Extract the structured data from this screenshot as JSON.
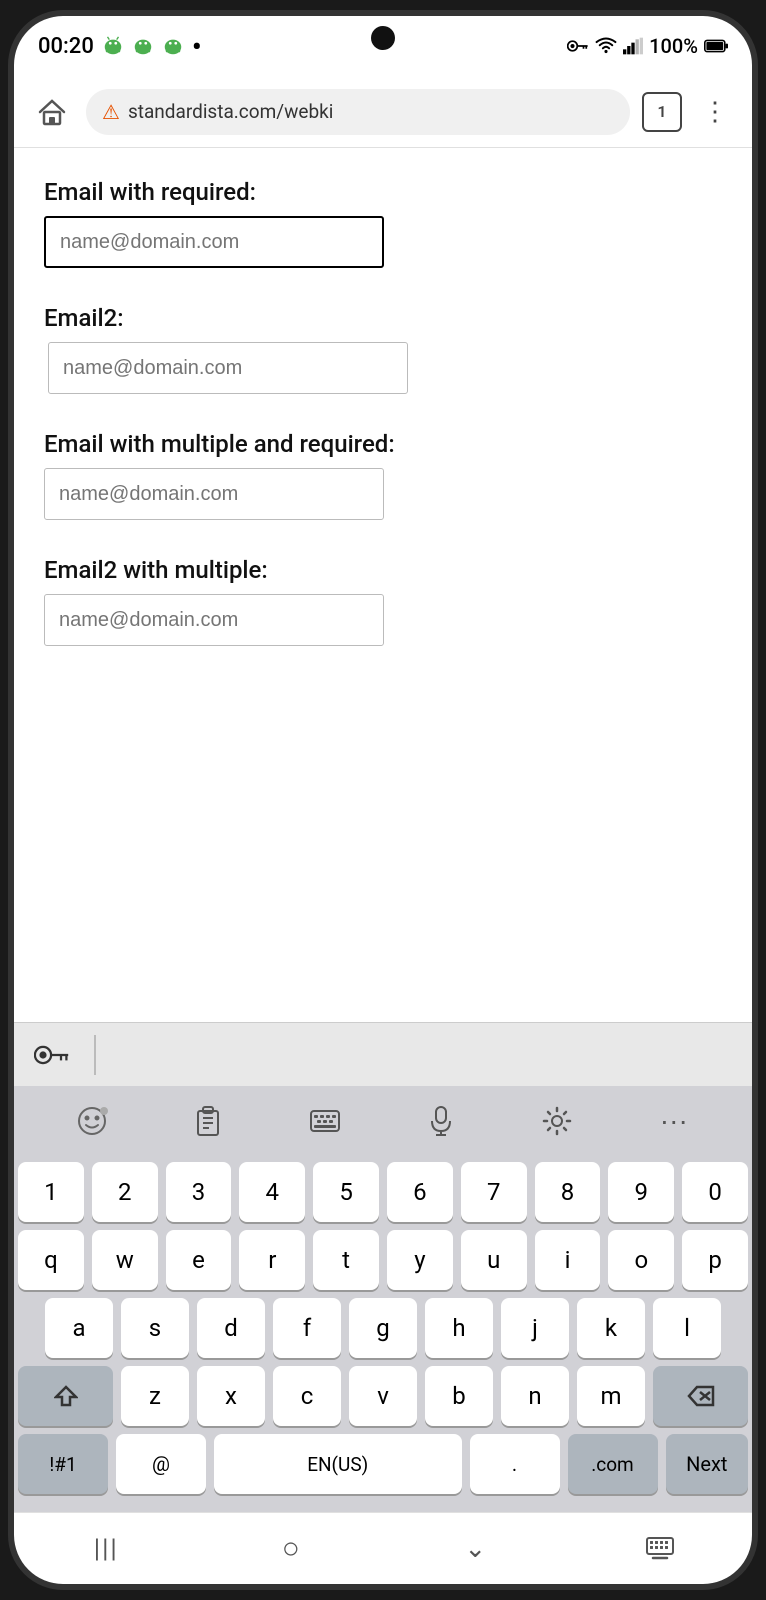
{
  "status": {
    "time": "00:20",
    "battery": "100%",
    "dot": "•"
  },
  "browser": {
    "url": "standardista.com/webki",
    "tab_count": "1"
  },
  "form": {
    "field1_label": "Email with required:",
    "field1_placeholder": "name@domain.com",
    "field2_label": "Email2:",
    "field2_placeholder": "name@domain.com",
    "field3_label": "Email with multiple and required:",
    "field3_placeholder": "name@domain.com",
    "field4_label": "Email2 with multiple:",
    "field4_placeholder": "name@domain.com"
  },
  "keyboard": {
    "row0": [
      "1",
      "2",
      "3",
      "4",
      "5",
      "6",
      "7",
      "8",
      "9",
      "0"
    ],
    "row1": [
      "q",
      "w",
      "e",
      "r",
      "t",
      "y",
      "u",
      "i",
      "o",
      "p"
    ],
    "row2": [
      "a",
      "s",
      "d",
      "f",
      "g",
      "h",
      "j",
      "k",
      "l"
    ],
    "row3": [
      "z",
      "x",
      "c",
      "v",
      "b",
      "n",
      "m"
    ],
    "bottom_left": "!#1",
    "at": "@",
    "space": "EN(US)",
    "dot": ".",
    "dot_com": ".com",
    "next": "Next"
  },
  "nav": {
    "back": "|||",
    "home": "○",
    "down": "˅",
    "keyboard": "⌨"
  }
}
